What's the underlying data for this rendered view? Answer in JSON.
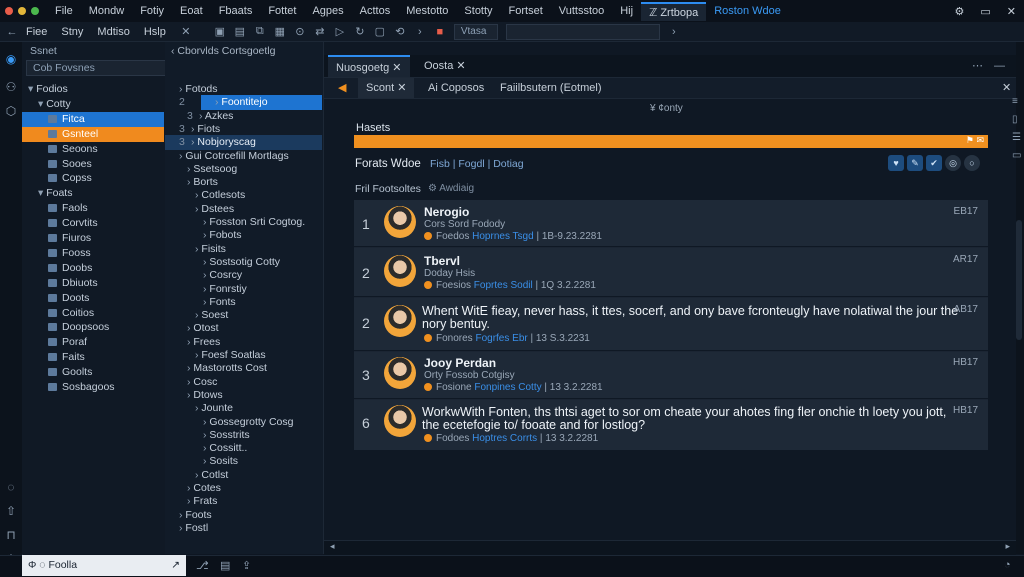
{
  "menubar": {
    "items": [
      "File",
      "Mondw",
      "Fotiy",
      "Eoat",
      "Fbaats",
      "Fottet",
      "Agpes",
      "Acttos",
      "Mestotto",
      "Stotty",
      "Fortset",
      "Vuttsstoo",
      "Hij"
    ],
    "active_tab": "ℤ Zrtbopa",
    "accent": "Roston Wdoe"
  },
  "toolbar": {
    "labels": [
      "Fiee",
      "Stny",
      "Mdtiso",
      "Hslp"
    ],
    "search_placeholder": "Vtasa"
  },
  "sidebar": {
    "filter_label": "Ssnet",
    "filter_value": "Cob Fovsnes",
    "items": [
      {
        "label": "Fodios",
        "level": 0,
        "state": ""
      },
      {
        "label": "Cotty",
        "level": 1,
        "state": ""
      },
      {
        "label": "Fitca",
        "level": 2,
        "state": "selected-blue"
      },
      {
        "label": "Gsnteel",
        "level": 2,
        "state": "selected-orange"
      },
      {
        "label": "Seoons",
        "level": 2,
        "state": ""
      },
      {
        "label": "Sooes",
        "level": 2,
        "state": ""
      },
      {
        "label": "Copss",
        "level": 2,
        "state": ""
      },
      {
        "label": "Foats",
        "level": 1,
        "state": ""
      },
      {
        "label": "Faols",
        "level": 2,
        "state": ""
      },
      {
        "label": "Corvtits",
        "level": 2,
        "state": ""
      },
      {
        "label": "Fiuros",
        "level": 2,
        "state": ""
      },
      {
        "label": "Fooss",
        "level": 2,
        "state": ""
      },
      {
        "label": "Doobs",
        "level": 2,
        "state": ""
      },
      {
        "label": "Dbiuots",
        "level": 2,
        "state": ""
      },
      {
        "label": "Doots",
        "level": 2,
        "state": ""
      },
      {
        "label": "Coitios",
        "level": 2,
        "state": ""
      },
      {
        "label": "Doopsoos",
        "level": 2,
        "state": ""
      },
      {
        "label": "Poraf",
        "level": 2,
        "state": ""
      },
      {
        "label": "Faits",
        "level": 2,
        "state": ""
      },
      {
        "label": "Goolts",
        "level": 2,
        "state": ""
      },
      {
        "label": "Sosbagoos",
        "level": 2,
        "state": ""
      }
    ]
  },
  "tree": {
    "breadcrumb": "Cborvlds Cortsgoetlg",
    "items": [
      {
        "num": "",
        "label": "Fotods",
        "indent": 1,
        "state": ""
      },
      {
        "num": "2",
        "label": "Foontitejo",
        "indent": 2,
        "state": "selected-blue"
      },
      {
        "num": "3",
        "label": "Azkes",
        "indent": 2,
        "state": ""
      },
      {
        "num": "3",
        "label": "Fiots",
        "indent": 1,
        "state": ""
      },
      {
        "num": "3",
        "label": "Nobjoryscag",
        "indent": 1,
        "state": "selected-dark"
      },
      {
        "num": "",
        "label": "Gui Cotrcefill Mortlags",
        "indent": 1,
        "state": ""
      },
      {
        "num": "",
        "label": "Ssetsoog",
        "indent": 2,
        "state": ""
      },
      {
        "num": "",
        "label": "Borts",
        "indent": 2,
        "state": ""
      },
      {
        "num": "",
        "label": "Cotlesots",
        "indent": 3,
        "state": ""
      },
      {
        "num": "",
        "label": "Dstees",
        "indent": 3,
        "state": ""
      },
      {
        "num": "",
        "label": "Fosston Srti Cogtog.",
        "indent": 4,
        "state": ""
      },
      {
        "num": "",
        "label": "Fobots",
        "indent": 4,
        "state": ""
      },
      {
        "num": "",
        "label": "Fisits",
        "indent": 3,
        "state": ""
      },
      {
        "num": "",
        "label": "Sostsotig Cotty",
        "indent": 4,
        "state": ""
      },
      {
        "num": "",
        "label": "Cosrcy",
        "indent": 4,
        "state": ""
      },
      {
        "num": "",
        "label": "Fonrstiy",
        "indent": 4,
        "state": ""
      },
      {
        "num": "",
        "label": "Fonts",
        "indent": 4,
        "state": ""
      },
      {
        "num": "",
        "label": "Soest",
        "indent": 3,
        "state": ""
      },
      {
        "num": "",
        "label": "Otost",
        "indent": 2,
        "state": ""
      },
      {
        "num": "",
        "label": "Frees",
        "indent": 2,
        "state": ""
      },
      {
        "num": "",
        "label": "Foesf Soatlas",
        "indent": 3,
        "state": ""
      },
      {
        "num": "",
        "label": "Mastorotts Cost",
        "indent": 2,
        "state": ""
      },
      {
        "num": "",
        "label": "Cosc",
        "indent": 2,
        "state": ""
      },
      {
        "num": "",
        "label": "Dtows",
        "indent": 2,
        "state": ""
      },
      {
        "num": "",
        "label": "Jounte",
        "indent": 3,
        "state": ""
      },
      {
        "num": "",
        "label": "Gossegrotty Cosg",
        "indent": 4,
        "state": ""
      },
      {
        "num": "",
        "label": "Sosstrits",
        "indent": 4,
        "state": ""
      },
      {
        "num": "",
        "label": "Cossitt..",
        "indent": 4,
        "state": ""
      },
      {
        "num": "",
        "label": "Sosits",
        "indent": 4,
        "state": ""
      },
      {
        "num": "",
        "label": "Cotlst",
        "indent": 3,
        "state": ""
      },
      {
        "num": "",
        "label": "Cotes",
        "indent": 2,
        "state": ""
      },
      {
        "num": "",
        "label": "Frats",
        "indent": 2,
        "state": ""
      },
      {
        "num": "",
        "label": "Foots",
        "indent": 1,
        "state": ""
      },
      {
        "num": "",
        "label": "Fostl",
        "indent": 1,
        "state": ""
      }
    ]
  },
  "editor": {
    "tabs_top": [
      "Nuosgoetg",
      "Oosta"
    ],
    "tabs_sub": [
      "Scont",
      "Ai Coposos",
      "Faiilbsutern (Eotmel)"
    ],
    "header_center": "¥ ¢onty",
    "heading": "Hasets",
    "section_title": "Forats Wdoe",
    "section_links": "Fisb | Fogdl | Dotiag",
    "subsection": "Fril Footsoltes",
    "subsection_hint": "Awdiaig",
    "socials": [
      "♥",
      "✎",
      "✔",
      "◎",
      "○"
    ],
    "posts": [
      {
        "rank": "1",
        "name": "Nerogio",
        "sub": "Cors Sord Fodody",
        "meta_label": "Foedos",
        "meta_link": "Hoprnes Tsgd",
        "meta_date": "1B-9.23.2281",
        "badge": "EB17"
      },
      {
        "rank": "2",
        "name": "Tbervl",
        "sub": "Doday Hsis",
        "meta_label": "Foesios",
        "meta_link": "Foprtes Sodil",
        "meta_date": "1Q 3.2.2281",
        "badge": "AR17"
      },
      {
        "rank": "2",
        "text": "Whent WitE fieay, never hass, it ttes, socerf, and ony bave fcronteugly have nolatiwal the jour the nory bentuy.",
        "meta_label": "Fonores",
        "meta_link": "Fogrfes Ebr",
        "meta_date": "13 S.3.2231",
        "badge": "AB17"
      },
      {
        "rank": "3",
        "name": "Jooy Perdan",
        "sub": "Orty Fossob Cotgisy",
        "meta_label": "Fosione",
        "meta_link": "Fonpines Cotty",
        "meta_date": "13 3.2.2281",
        "badge": "HB17"
      },
      {
        "rank": "6",
        "text": "WorkwWith Fonten, ths thtsi aget to sor om cheate your ahotes fing fler onchie th loety you jott, the ecetefogie to/ fooate and for lostlog?",
        "meta_label": "Fodoes",
        "meta_link": "Hoptres Corrts",
        "meta_date": "13 3.2.2281",
        "badge": "HB17"
      }
    ]
  },
  "statusbar": {
    "left_label": "Φ ◌ Foolla"
  }
}
